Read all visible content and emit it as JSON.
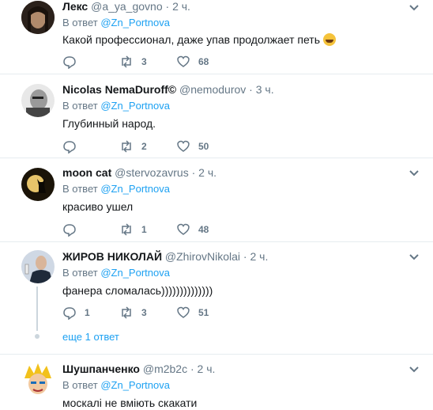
{
  "colors": {
    "accent": "#1da1f2",
    "muted": "#657786",
    "text": "#14171a",
    "separator": "#e6ecf0"
  },
  "tweets": [
    {
      "name": "Лекс",
      "handle": "@a_ya_govno",
      "dot": "·",
      "time": "2 ч.",
      "reply_prefix": "В ответ",
      "reply_to": "@Zn_Portnova",
      "text": "Какой профессионал, даже упав продолжает петь",
      "emoji": "grinning-face-emoji",
      "replies": "",
      "retweets": "3",
      "likes": "68"
    },
    {
      "name": "Nicolas NemaDuroff©",
      "handle": "@nemodurov",
      "dot": "·",
      "time": "3 ч.",
      "reply_prefix": "В ответ",
      "reply_to": "@Zn_Portnova",
      "text": "Глубинный народ.",
      "replies": "",
      "retweets": "2",
      "likes": "50"
    },
    {
      "name": "moon cat",
      "handle": "@stervozavrus",
      "dot": "·",
      "time": "2 ч.",
      "reply_prefix": "В ответ",
      "reply_to": "@Zn_Portnova",
      "text": "красиво ушел",
      "replies": "",
      "retweets": "1",
      "likes": "48"
    },
    {
      "name": "ЖИРОВ НИКОЛАЙ",
      "handle": "@ZhirovNikolai",
      "dot": "·",
      "time": "2 ч.",
      "reply_prefix": "В ответ",
      "reply_to": "@Zn_Portnova",
      "text": "фанера сломалась))))))))))))))",
      "replies": "1",
      "retweets": "3",
      "likes": "51",
      "more_replies": "еще 1 ответ"
    },
    {
      "name": "Шушпанченко",
      "handle": "@m2b2c",
      "dot": "·",
      "time": "2 ч.",
      "reply_prefix": "В ответ",
      "reply_to": "@Zn_Portnova",
      "text": "москалі не вміють скакати"
    }
  ]
}
